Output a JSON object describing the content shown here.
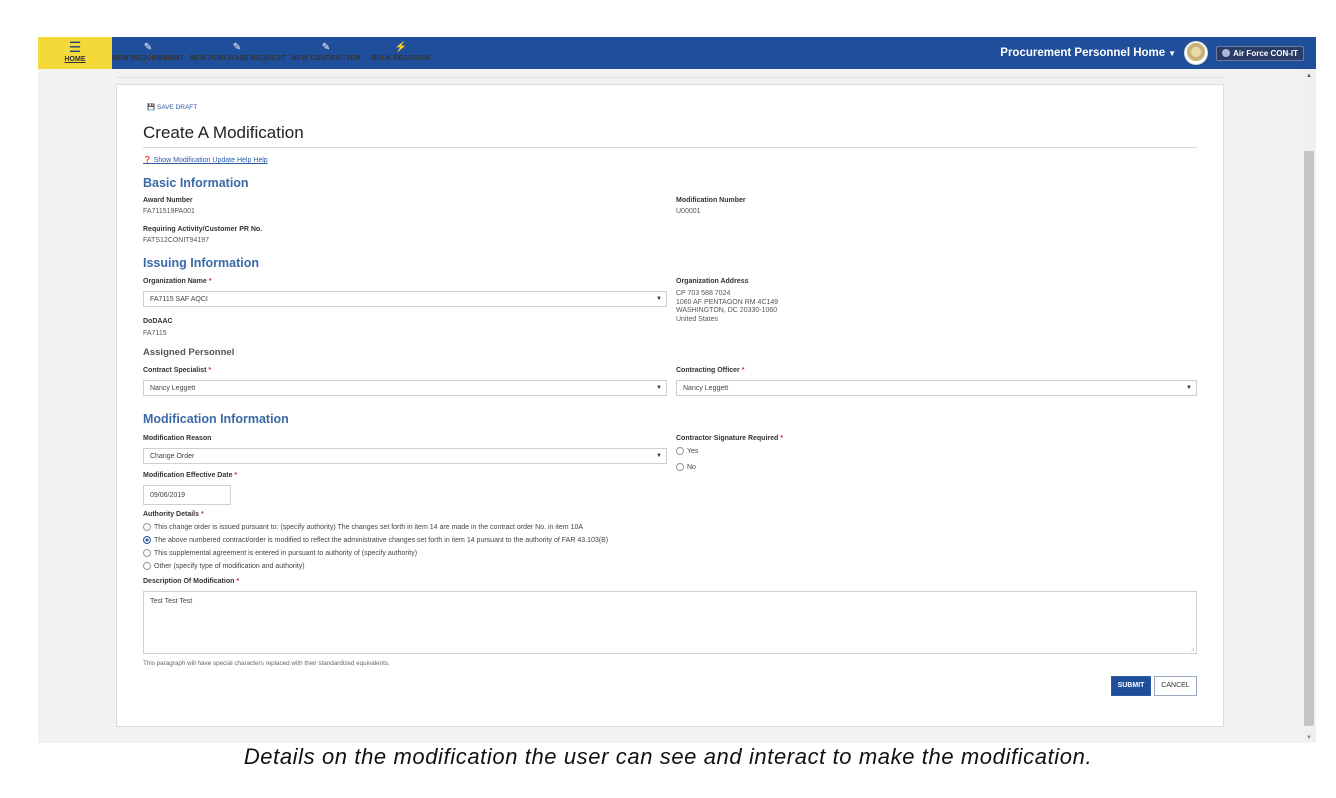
{
  "nav": {
    "home": "HOME",
    "items": [
      "NEW REQUIREMENT",
      "NEW PURCHASE REQUEST",
      "NEW CONTRACTOR",
      "BULK REASSIGN"
    ],
    "user_menu": "Procurement Personnel Home",
    "brand": "Air Force CON-IT"
  },
  "form": {
    "save_draft": "SAVE DRAFT",
    "title": "Create A Modification",
    "help_link": "Show Modification Update Help Help",
    "basic": {
      "heading": "Basic Information",
      "award_label": "Award Number",
      "award_value": "FA711519PA001",
      "mod_num_label": "Modification Number",
      "mod_num_value": "U00001",
      "req_label": "Requiring Activity/Customer PR No.",
      "req_value": "FATS12CONIT94197"
    },
    "issuing": {
      "heading": "Issuing Information",
      "org_name_label": "Organization Name",
      "org_name_value": "FA7115 SAF AQCI",
      "org_addr_label": "Organization Address",
      "org_addr_lines": [
        "CP 703 588 7024",
        "1060 AF PENTAGON   RM 4C149",
        "WASHINGTON, DC 20330-1060",
        "United States"
      ],
      "dodaac_label": "DoDAAC",
      "dodaac_value": "FA7115"
    },
    "personnel": {
      "heading": "Assigned Personnel",
      "specialist_label": "Contract Specialist",
      "specialist_value": "Nancy Leggett",
      "officer_label": "Contracting Officer",
      "officer_value": "Nancy Leggett"
    },
    "modification": {
      "heading": "Modification Information",
      "reason_label": "Modification Reason",
      "reason_value": "Change Order",
      "signature_label": "Contractor Signature Required",
      "signature_options": [
        "Yes",
        "No"
      ],
      "date_label": "Modification Effective Date",
      "date_value": "09/06/2019",
      "authority_label": "Authority Details",
      "authority_options": [
        "This change order is issued pursuant to: (specify authority) The changes set forth in item 14 are made in the contract order No. in item 10A",
        "The above numbered contract/order is modified to reflect the administrative changes set forth in item 14 pursuant to the authority of FAR 43.103(B)",
        "This supplemental agreement is entered in pursuant to authority of (specify authority)",
        "Other (specify type of modification and authority)"
      ],
      "authority_selected": 1,
      "description_label": "Description Of Modification",
      "description_value": "Test Test Test",
      "note": "This paragraph will have special characters replaced with their standardized equivalents."
    },
    "submit": "SUBMIT",
    "cancel": "CANCEL"
  },
  "caption": "Details on the modification the user can see and interact to make the modification."
}
